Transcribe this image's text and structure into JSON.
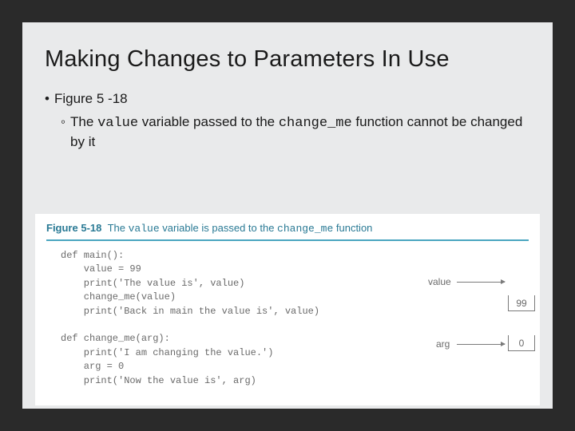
{
  "slide": {
    "title": "Making Changes to Parameters In Use",
    "bullet1": "Figure 5 -18",
    "bullet2_parts": {
      "pre": "The ",
      "code1": "value",
      "mid": " variable passed to the ",
      "code2": "change_me",
      "post": " function cannot be changed by it"
    }
  },
  "figure": {
    "caption_label": "Figure 5-18",
    "caption_pre": "The ",
    "caption_code1": "value",
    "caption_mid": " variable is passed to the ",
    "caption_code2": "change_me",
    "caption_post": " function",
    "code": "def main():\n    value = 99\n    print('The value is', value)\n    change_me(value)\n    print('Back in main the value is', value)\n\ndef change_me(arg):\n    print('I am changing the value.')\n    arg = 0\n    print('Now the value is', arg)",
    "labels": {
      "value": "value",
      "arg": "arg",
      "box_value": "99",
      "box_arg": "0"
    }
  }
}
